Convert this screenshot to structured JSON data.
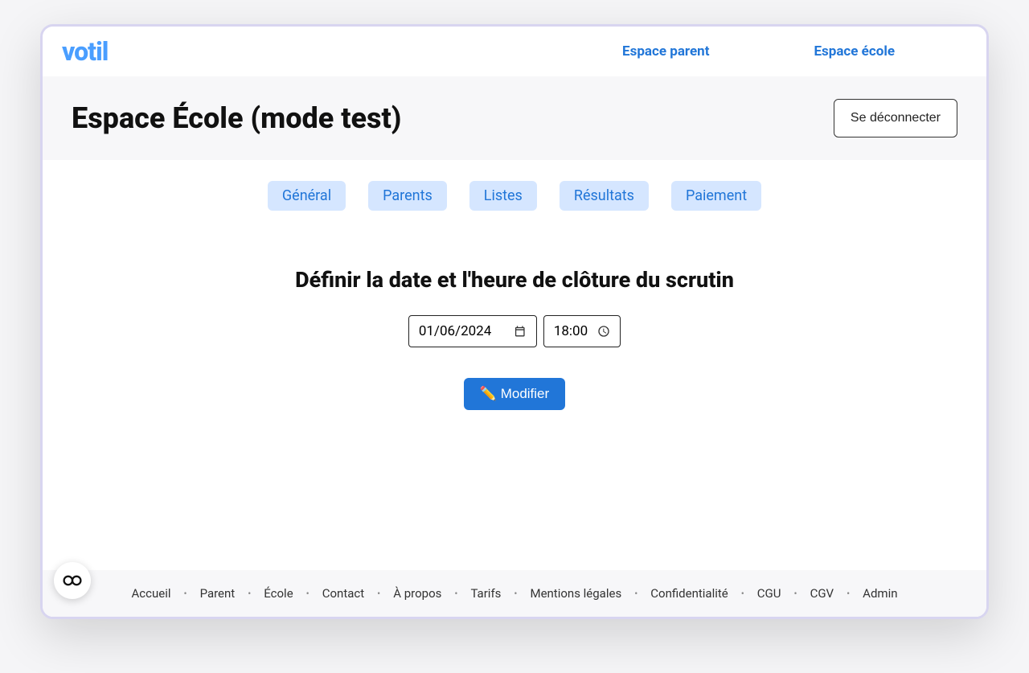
{
  "logo": "votil",
  "top_nav": {
    "parent": "Espace parent",
    "school": "Espace école"
  },
  "header": {
    "title": "Espace École (mode test)",
    "logout": "Se déconnecter"
  },
  "tabs": {
    "general": "Général",
    "parents": "Parents",
    "lists": "Listes",
    "results": "Résultats",
    "payment": "Paiement"
  },
  "main": {
    "heading": "Définir la date et l'heure de clôture du scrutin",
    "date_value": "01/06/2024",
    "time_value": "18:00",
    "modify_label": "✏️ Modifier"
  },
  "footer": {
    "links": {
      "home": "Accueil",
      "parent": "Parent",
      "school": "École",
      "contact": "Contact",
      "about": "À propos",
      "pricing": "Tarifs",
      "legal": "Mentions légales",
      "privacy": "Confidentialité",
      "cgu": "CGU",
      "cgv": "CGV",
      "admin": "Admin"
    }
  }
}
